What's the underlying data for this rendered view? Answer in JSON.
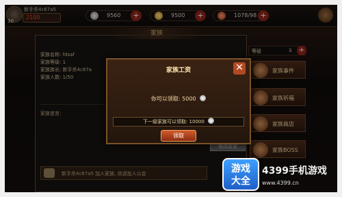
{
  "player": {
    "name": "新手杀4c67a5",
    "level": "30",
    "power": "2100",
    "name_display": "新手杀4c67a5"
  },
  "resources": [
    {
      "value": "9560",
      "icon": "silver-coin-icon"
    },
    {
      "value": "9500",
      "icon": "gold-ingot-icon"
    },
    {
      "value": "1078/98",
      "icon": "stamina-icon"
    }
  ],
  "panel": {
    "title": "家族",
    "info": [
      "家族名称: fdsaf",
      "家族等级: 1",
      "家族族长: 新手杀4c67a",
      "家族人数: 1/50"
    ],
    "notice_label": "家族宣言:",
    "gray_button": "修改宣言",
    "chat_text": "新手杀4c67a5 加入家族, 欢迎加入公会"
  },
  "modal": {
    "title": "家族工资",
    "amount_label": "你可以领取: 5000",
    "next_label": "下一级家族可以领取: 10000",
    "collect_button": "领取"
  },
  "sidebar": {
    "level_label": "等级",
    "level_value": "3",
    "buttons": [
      {
        "label": "家族事件"
      },
      {
        "label": "家族祈福"
      },
      {
        "label": "家族商店"
      },
      {
        "label": "家族BOSS"
      }
    ]
  },
  "watermark": {
    "logo_line1": "游戏",
    "logo_line2": "大全",
    "brand": "4399手机游戏",
    "url": "www.4399.cn"
  },
  "colors": {
    "accent": "#d15a2a",
    "gold_text": "#f3d9a3",
    "bg": "#120d0c"
  }
}
